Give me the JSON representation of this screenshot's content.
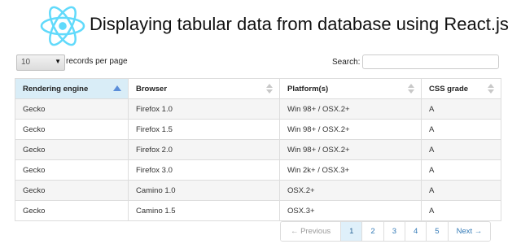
{
  "header": {
    "title": "Displaying tabular data from database using React.js",
    "logo_color": "#61dafb"
  },
  "controls": {
    "length_value": "10",
    "length_label": "records per page",
    "search_label": "Search:",
    "search_value": ""
  },
  "table": {
    "columns": [
      "Rendering engine",
      "Browser",
      "Platform(s)",
      "CSS grade"
    ],
    "sorted_column": "Rendering engine",
    "rows": [
      [
        "Gecko",
        "Firefox 1.0",
        "Win 98+ / OSX.2+",
        "A"
      ],
      [
        "Gecko",
        "Firefox 1.5",
        "Win 98+ / OSX.2+",
        "A"
      ],
      [
        "Gecko",
        "Firefox 2.0",
        "Win 98+ / OSX.2+",
        "A"
      ],
      [
        "Gecko",
        "Firefox 3.0",
        "Win 2k+ / OSX.3+",
        "A"
      ],
      [
        "Gecko",
        "Camino 1.0",
        "OSX.2+",
        "A"
      ],
      [
        "Gecko",
        "Camino 1.5",
        "OSX.3+",
        "A"
      ]
    ]
  },
  "pagination": {
    "previous": "← Previous",
    "pages": [
      "1",
      "2",
      "3",
      "4",
      "5"
    ],
    "active_page": "1",
    "next": "Next →"
  }
}
